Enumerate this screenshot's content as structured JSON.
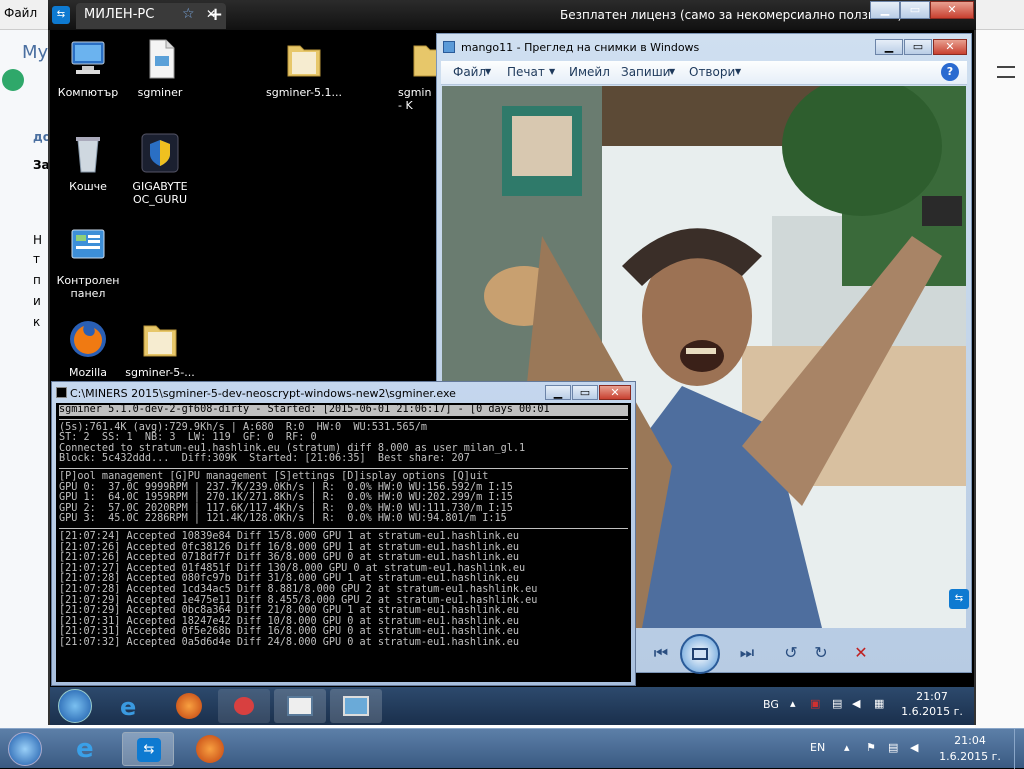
{
  "outer": {
    "left_label": "Файл",
    "license_text": "Безплатен лиценз (само за некомерсиално ползване)",
    "right_pct": "%",
    "left_letters": [
      "My",
      "до",
      "За",
      "Н",
      "т",
      "п",
      "и",
      "к"
    ]
  },
  "teamviewer": {
    "tab_label": "МИЛЕН-PC",
    "new_tab": "+",
    "close_tab": "✕",
    "star": "☆"
  },
  "desktop": {
    "icons": [
      {
        "label": "Компютър"
      },
      {
        "label": "sgminer"
      },
      {
        "label": "sgminer-5.1..."
      },
      {
        "label": "sgmin - K"
      },
      {
        "label": "Кошче"
      },
      {
        "label": "GIGABYTE OC_GURU"
      },
      {
        "label": "Контролен панел"
      },
      {
        "label": "Mozilla"
      },
      {
        "label": "sgminer-5-..."
      }
    ]
  },
  "photo_viewer": {
    "title": "mango11 - Преглед на снимки в Windows",
    "menu": [
      "Файл",
      "Печат",
      "Имейл",
      "Запиши",
      "Отвори"
    ],
    "help": "?"
  },
  "console": {
    "title": "C:\\MINERS 2015\\sgminer-5-dev-neoscrypt-windows-new2\\sgminer.exe",
    "header": "sgminer 5.1.0-dev-2-gf608-dirty - Started: [2015-06-01 21:06:17] - [0 days 00:01",
    "stats": [
      "(5s):761.4K (avg):729.9Kh/s | A:680  R:0  HW:0  WU:531.565/m",
      "ST: 2  SS: 1  NB: 3  LW: 119  GF: 0  RF: 0",
      "Connected to stratum-eu1.hashlink.eu (stratum) diff 8.000 as user milan_gl.1",
      "Block: 5c432ddd...  Diff:309K  Started: [21:06:35]  Best share: 207"
    ],
    "menu_line": "[P]ool management [G]PU management [S]ettings [D]isplay options [Q]uit",
    "gpus": [
      "GPU 0:  37.0C 9999RPM | 237.7K/239.0Kh/s | R:  0.0% HW:0 WU:156.592/m I:15",
      "GPU 1:  64.0C 1959RPM | 270.1K/271.8Kh/s | R:  0.0% HW:0 WU:202.299/m I:15",
      "GPU 2:  57.0C 2020RPM | 117.6K/117.4Kh/s | R:  0.0% HW:0 WU:111.730/m I:15",
      "GPU 3:  45.0C 2286RPM | 121.4K/128.0Kh/s | R:  0.0% HW:0 WU:94.801/m I:15"
    ],
    "log": [
      "[21:07:24] Accepted 10839e84 Diff 15/8.000 GPU 1 at stratum-eu1.hashlink.eu",
      "[21:07:26] Accepted 0fc38126 Diff 16/8.000 GPU 1 at stratum-eu1.hashlink.eu",
      "[21:07:26] Accepted 0718df7f Diff 36/8.000 GPU 0 at stratum-eu1.hashlink.eu",
      "[21:07:27] Accepted 01f4851f Diff 130/8.000 GPU 0 at stratum-eu1.hashlink.eu",
      "[21:07:28] Accepted 080fc97b Diff 31/8.000 GPU 1 at stratum-eu1.hashlink.eu",
      "[21:07:28] Accepted 1cd34ac5 Diff 8.881/8.000 GPU 2 at stratum-eu1.hashlink.eu",
      "[21:07:29] Accepted 1e475e11 Diff 8.455/8.000 GPU 2 at stratum-eu1.hashlink.eu",
      "[21:07:29] Accepted 0bc8a364 Diff 21/8.000 GPU 1 at stratum-eu1.hashlink.eu",
      "[21:07:31] Accepted 18247e42 Diff 10/8.000 GPU 0 at stratum-eu1.hashlink.eu",
      "[21:07:31] Accepted 0f5e268b Diff 16/8.000 GPU 0 at stratum-eu1.hashlink.eu",
      "[21:07:32] Accepted 0a5d6d4e Diff 24/8.000 GPU 0 at stratum-eu1.hashlink.eu"
    ]
  },
  "inner_taskbar": {
    "lang": "BG",
    "time": "21:07",
    "date": "1.6.2015 г."
  },
  "outer_taskbar": {
    "lang": "EN",
    "time": "21:04",
    "date": "1.6.2015 г."
  }
}
